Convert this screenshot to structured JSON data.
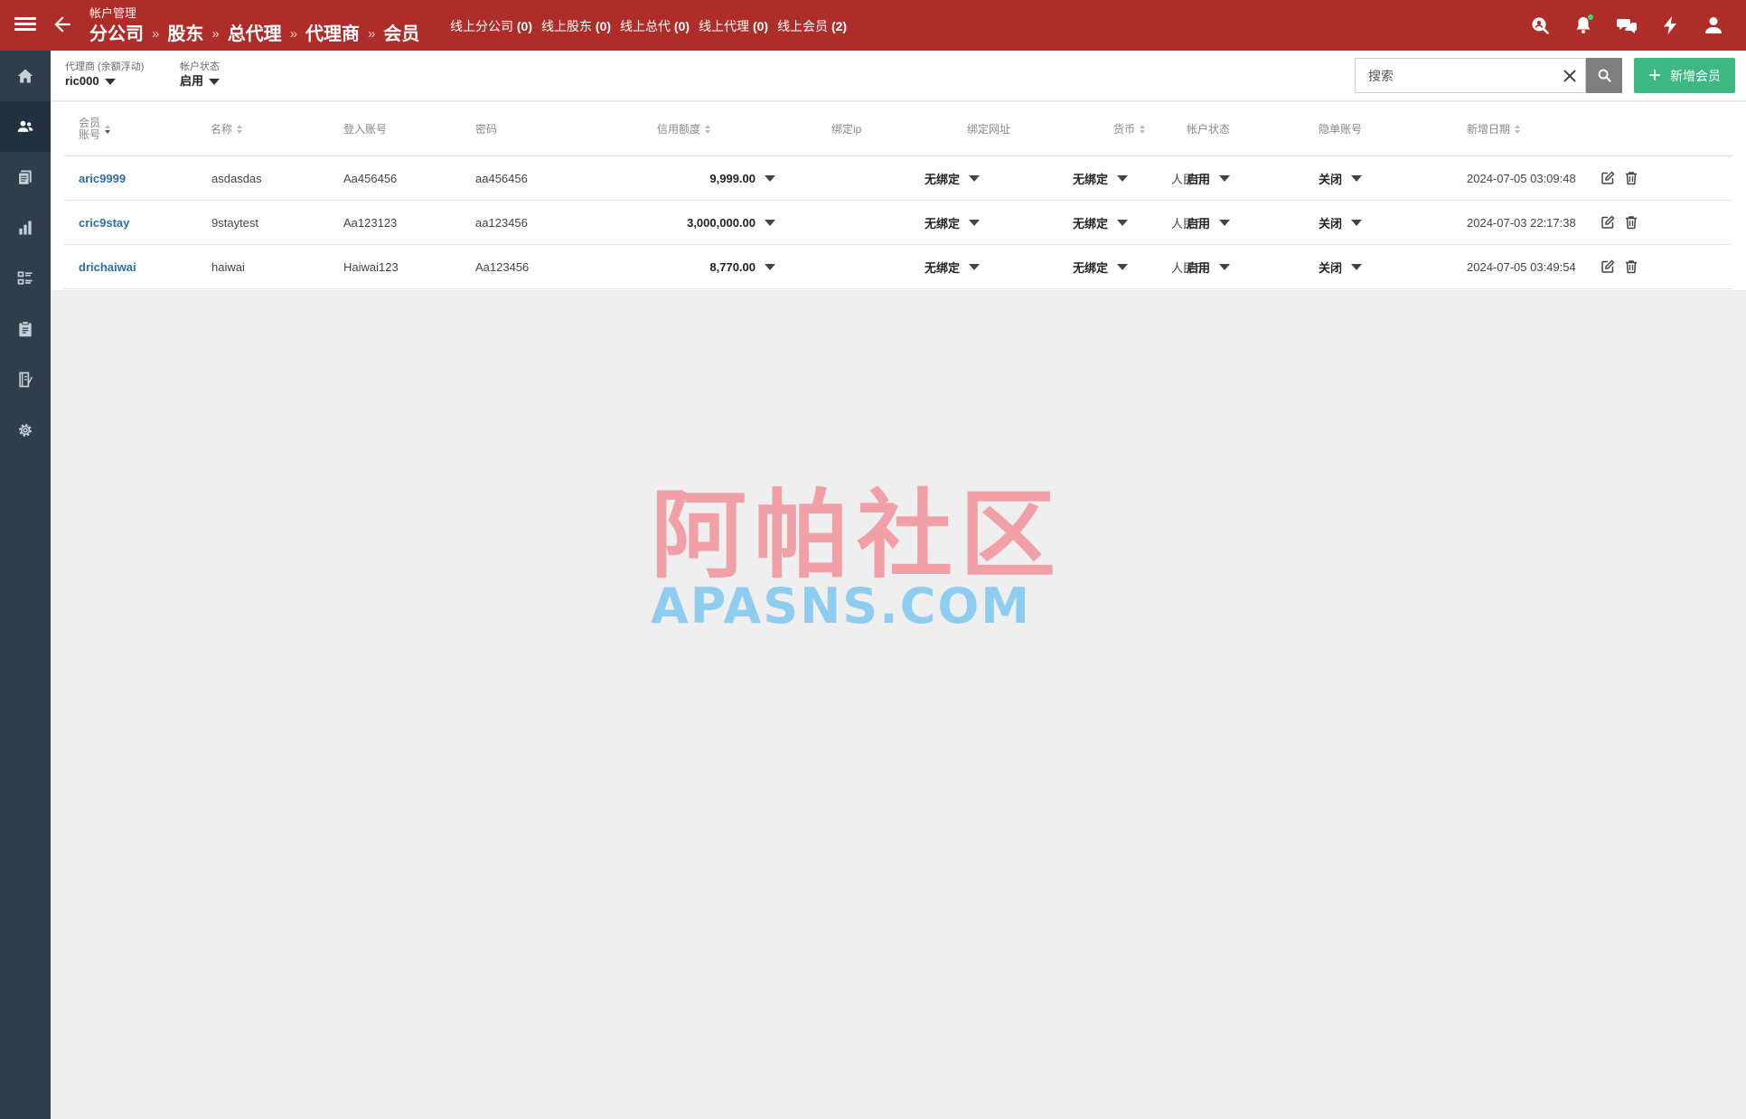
{
  "header": {
    "section_label": "帐户管理",
    "breadcrumbs": [
      "分公司",
      "股东",
      "总代理",
      "代理商",
      "会员"
    ],
    "breadcrumb_separator": "»",
    "online_stats": [
      {
        "label": "线上分公司",
        "count": "(0)"
      },
      {
        "label": "线上股东",
        "count": "(0)"
      },
      {
        "label": "线上总代",
        "count": "(0)"
      },
      {
        "label": "线上代理",
        "count": "(0)"
      },
      {
        "label": "线上会员",
        "count": "(2)"
      }
    ],
    "icons": [
      "search-user-icon",
      "bell-icon",
      "chat-icon",
      "lightning-icon",
      "user-icon"
    ],
    "bg_color": "#ae2d29"
  },
  "sidebar": {
    "items": [
      {
        "icon": "home-icon"
      },
      {
        "icon": "users-icon",
        "active": true
      },
      {
        "icon": "documents-icon"
      },
      {
        "icon": "bar-chart-icon"
      },
      {
        "icon": "list-icon"
      },
      {
        "icon": "clipboard-icon"
      },
      {
        "icon": "notebook-icon"
      },
      {
        "icon": "gear-icon"
      }
    ]
  },
  "filters": {
    "agent": {
      "label": "代理商 (余额浮动)",
      "value": "ric000"
    },
    "status": {
      "label": "帐户状态",
      "value": "启用"
    }
  },
  "search": {
    "placeholder": "搜索",
    "value": ""
  },
  "add_button": {
    "label": "新增会员",
    "color": "#3cb882"
  },
  "table": {
    "headers": {
      "account_line1": "会员",
      "account_line2": "账号",
      "name": "名称",
      "login": "登入账号",
      "password": "密码",
      "credit": "信用额度",
      "bind_ip": "绑定ip",
      "bind_url": "绑定网址",
      "currency": "货币",
      "status": "帐户状态",
      "hidden": "隐单账号",
      "date": "新增日期"
    },
    "rows": [
      {
        "account": "aric9999",
        "name": "asdasdas",
        "login": "Aa456456",
        "password": "aa456456",
        "credit": "9,999.00",
        "bind_ip": "无绑定",
        "bind_url": "无绑定",
        "currency": "人民币",
        "status": "启用",
        "hidden": "关闭",
        "date": "2024-07-05 03:09:48"
      },
      {
        "account": "cric9stay",
        "name": "9staytest",
        "login": "Aa123123",
        "password": "aa123456",
        "credit": "3,000,000.00",
        "bind_ip": "无绑定",
        "bind_url": "无绑定",
        "currency": "人民币",
        "status": "启用",
        "hidden": "关闭",
        "date": "2024-07-03 22:17:38"
      },
      {
        "account": "drichaiwai",
        "name": "haiwai",
        "login": "Haiwai123",
        "password": "Aa123456",
        "credit": "8,770.00",
        "bind_ip": "无绑定",
        "bind_url": "无绑定",
        "currency": "人民币",
        "status": "启用",
        "hidden": "关闭",
        "date": "2024-07-05 03:49:54"
      }
    ]
  },
  "watermark": {
    "cn": "阿帕社区",
    "en": "APASNS.COM"
  }
}
